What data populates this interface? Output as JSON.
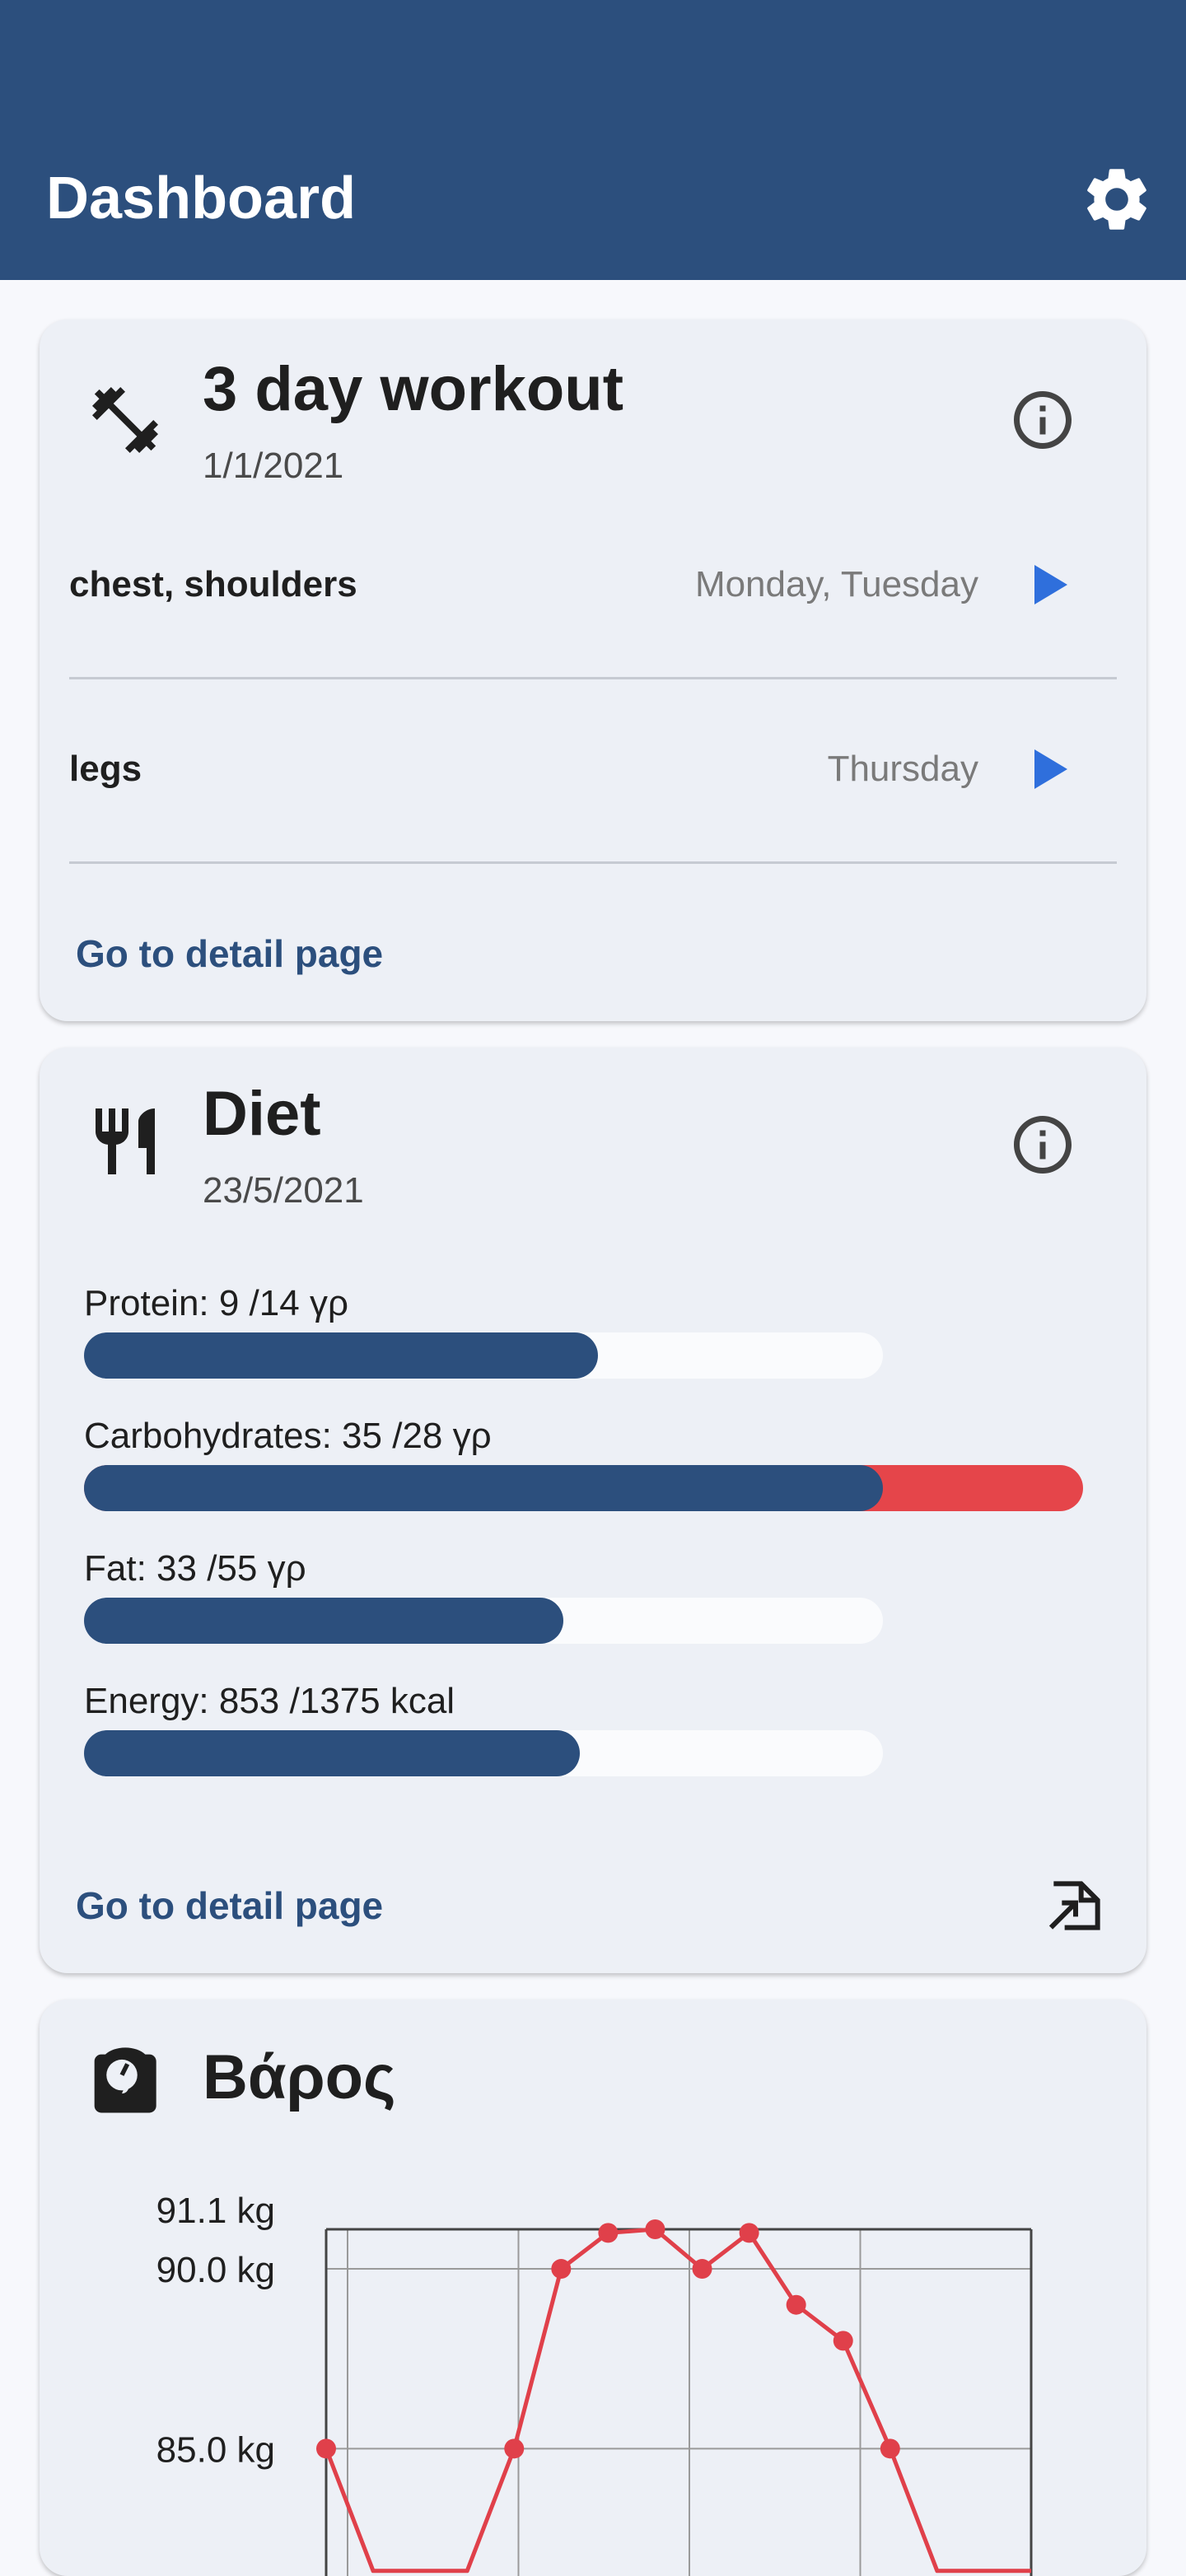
{
  "appbar": {
    "title": "Dashboard",
    "settings_icon": "gear-icon"
  },
  "workout": {
    "icon": "dumbbell-icon",
    "title": "3 day workout",
    "date": "1/1/2021",
    "info_icon": "info-icon",
    "rows": [
      {
        "name": "chest, shoulders",
        "days": "Monday, Tuesday",
        "action_icon": "play-icon"
      },
      {
        "name": "legs",
        "days": "Thursday",
        "action_icon": "play-icon"
      }
    ],
    "detail_label": "Go to detail page"
  },
  "diet": {
    "icon": "fork-knife-icon",
    "title": "Diet",
    "date": "23/5/2021",
    "info_icon": "info-icon",
    "nutrients": [
      {
        "label": "Protein: 9 /14 γρ",
        "value": 9,
        "goal": 14
      },
      {
        "label": "Carbohydrates: 35 /28 γρ",
        "value": 35,
        "goal": 28
      },
      {
        "label": "Fat: 33 /55 γρ",
        "value": 33,
        "goal": 55
      },
      {
        "label": "Energy: 853 /1375 kcal",
        "value": 853,
        "goal": 1375
      }
    ],
    "detail_label": "Go to detail page",
    "export_icon": "export-icon"
  },
  "weight": {
    "icon": "scale-icon",
    "title": "Βάρος"
  },
  "colors": {
    "primary": "#2c4f7d",
    "over_goal": "#e5454a",
    "play": "#2f6fdc",
    "chart_line": "#e0404a",
    "card": "#edf0f6"
  },
  "chart_data": {
    "type": "line",
    "y_tick_labels": [
      "91.1 kg",
      "90.0 kg",
      "85.0 kg"
    ],
    "y_ticks": [
      91.1,
      90.0,
      85.0
    ],
    "series": [
      {
        "x": [
          0,
          1,
          2,
          3,
          4,
          5,
          6,
          7,
          8,
          9,
          10,
          11,
          12,
          13,
          14,
          15
        ],
        "values": [
          85.0,
          81.6,
          81.6,
          81.6,
          85.0,
          90.0,
          91.0,
          91.1,
          90.0,
          91.0,
          89.0,
          88.0,
          85.0,
          81.6,
          81.6,
          81.6
        ]
      }
    ]
  }
}
